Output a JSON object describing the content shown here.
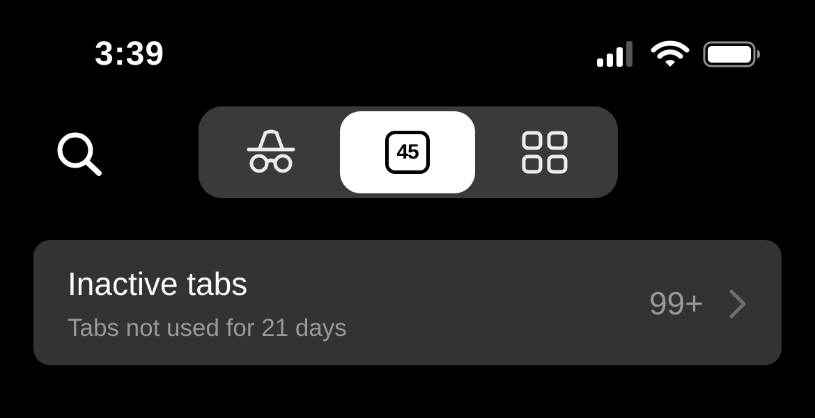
{
  "status_bar": {
    "time": "3:39",
    "signal_icon": "cellular-signal-icon",
    "wifi_icon": "wifi-icon",
    "battery_icon": "battery-icon"
  },
  "toolbar": {
    "search_icon": "search-icon",
    "segments": [
      {
        "name": "private",
        "icon": "incognito-icon",
        "selected": false
      },
      {
        "name": "tabs",
        "icon": "tab-count-icon",
        "count": "45",
        "selected": true
      },
      {
        "name": "groups",
        "icon": "grid-icon",
        "selected": false
      }
    ]
  },
  "inactive_tabs": {
    "title": "Inactive tabs",
    "subtitle": "Tabs not used for 21 days",
    "count": "99+",
    "chevron_icon": "chevron-right-icon"
  },
  "colors": {
    "background": "#000000",
    "segment_bg": "#3a3a3c",
    "selected_segment": "#ffffff",
    "card_bg": "#333336",
    "secondary_text": "#98989d"
  }
}
